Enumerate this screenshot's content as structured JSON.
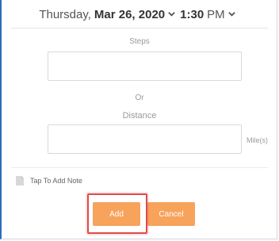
{
  "header": {
    "weekday": "Thursday,",
    "date": "Mar 26, 2020",
    "time": "1:30",
    "ampm": "PM"
  },
  "steps": {
    "label": "Steps",
    "value": "",
    "placeholder": ""
  },
  "or_text": "Or",
  "distance": {
    "label": "Distance",
    "value": "",
    "placeholder": "",
    "unit": "Mile(s)"
  },
  "note": {
    "label": "Tap To Add Note",
    "icon": "note-icon"
  },
  "actions": {
    "add_label": "Add",
    "cancel_label": "Cancel"
  },
  "colors": {
    "accent": "#f7a35c",
    "highlight": "#e04a4a",
    "frame": "#2a6ebd"
  }
}
